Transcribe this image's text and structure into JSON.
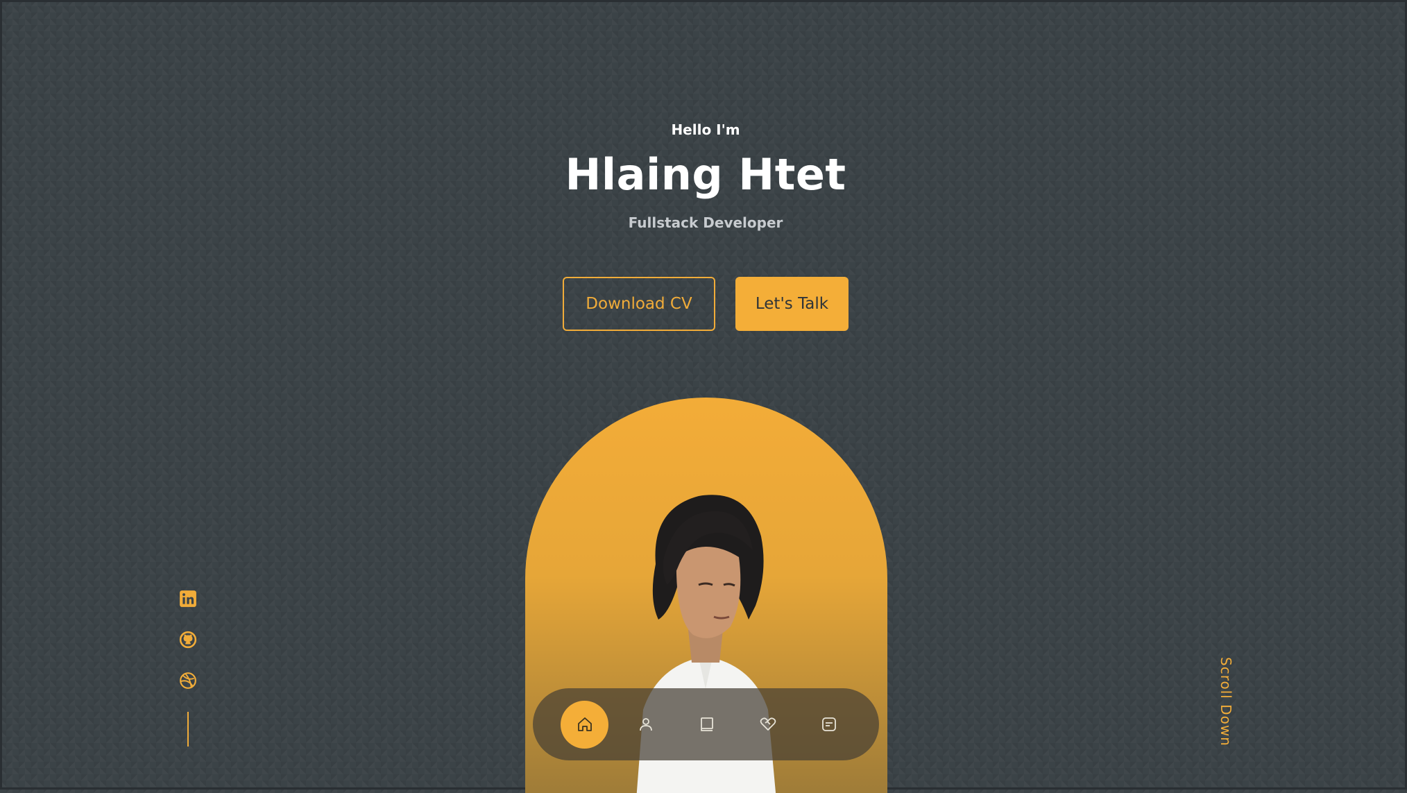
{
  "hero": {
    "greeting": "Hello I'm",
    "name": "Hlaing Htet",
    "role": "Fullstack Developer"
  },
  "actions": {
    "download_cv": "Download CV",
    "lets_talk": "Let's Talk"
  },
  "social": {
    "items": [
      {
        "icon": "linkedin-icon"
      },
      {
        "icon": "github-icon"
      },
      {
        "icon": "dribbble-icon"
      }
    ]
  },
  "scroll": {
    "label": "Scroll Down"
  },
  "nav": {
    "items": [
      {
        "icon": "home-icon",
        "active": true
      },
      {
        "icon": "user-icon",
        "active": false
      },
      {
        "icon": "book-icon",
        "active": false
      },
      {
        "icon": "handshake-icon",
        "active": false
      },
      {
        "icon": "message-icon",
        "active": false
      }
    ]
  },
  "colors": {
    "background": "#3b4347",
    "accent": "#f4ae38",
    "text_primary": "#ffffff",
    "text_muted": "#c7cbcf",
    "nav_bg": "#464034"
  }
}
